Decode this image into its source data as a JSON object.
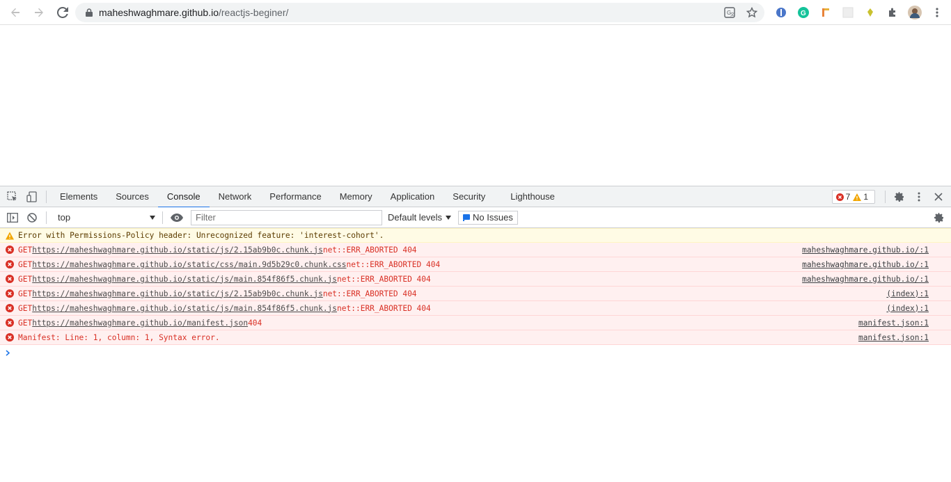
{
  "browser": {
    "url_host": "maheshwaghmare.github.io",
    "url_path": "/reactjs-beginer/"
  },
  "devtools": {
    "tabs": [
      "Elements",
      "Sources",
      "Console",
      "Network",
      "Performance",
      "Memory",
      "Application",
      "Security",
      "Lighthouse"
    ],
    "active_tab": "Console",
    "error_count": "7",
    "warning_count": "1",
    "context": "top",
    "filter_placeholder": "Filter",
    "levels": "Default levels",
    "issues": "No Issues"
  },
  "console": {
    "messages": [
      {
        "level": "warning",
        "text": "Error with Permissions-Policy header: Unrecognized feature: 'interest-cohort'.",
        "source": ""
      },
      {
        "level": "error",
        "prefix": "GET ",
        "url": "https://maheshwaghmare.github.io/static/js/2.15ab9b0c.chunk.js",
        "suffix": " net::ERR_ABORTED 404",
        "source": "maheshwaghmare.github.io/:1"
      },
      {
        "level": "error",
        "prefix": "GET ",
        "url": "https://maheshwaghmare.github.io/static/css/main.9d5b29c0.chunk.css",
        "suffix": " net::ERR_ABORTED 404",
        "source": "maheshwaghmare.github.io/:1"
      },
      {
        "level": "error",
        "prefix": "GET ",
        "url": "https://maheshwaghmare.github.io/static/js/main.854f86f5.chunk.js",
        "suffix": " net::ERR_ABORTED 404",
        "source": "maheshwaghmare.github.io/:1"
      },
      {
        "level": "error",
        "prefix": "GET ",
        "url": "https://maheshwaghmare.github.io/static/js/2.15ab9b0c.chunk.js",
        "suffix": " net::ERR_ABORTED 404",
        "source": "(index):1"
      },
      {
        "level": "error",
        "prefix": "GET ",
        "url": "https://maheshwaghmare.github.io/static/js/main.854f86f5.chunk.js",
        "suffix": " net::ERR_ABORTED 404",
        "source": "(index):1"
      },
      {
        "level": "error",
        "prefix": "GET ",
        "url": "https://maheshwaghmare.github.io/manifest.json",
        "suffix": " 404",
        "source": "manifest.json:1"
      },
      {
        "level": "error",
        "prefix": "Manifest: Line: 1, column: 1, Syntax error.",
        "url": "",
        "suffix": "",
        "source": "manifest.json:1"
      }
    ]
  },
  "colors": {
    "error": "#d93025",
    "warning": "#f2a600",
    "accent": "#1a73e8"
  }
}
